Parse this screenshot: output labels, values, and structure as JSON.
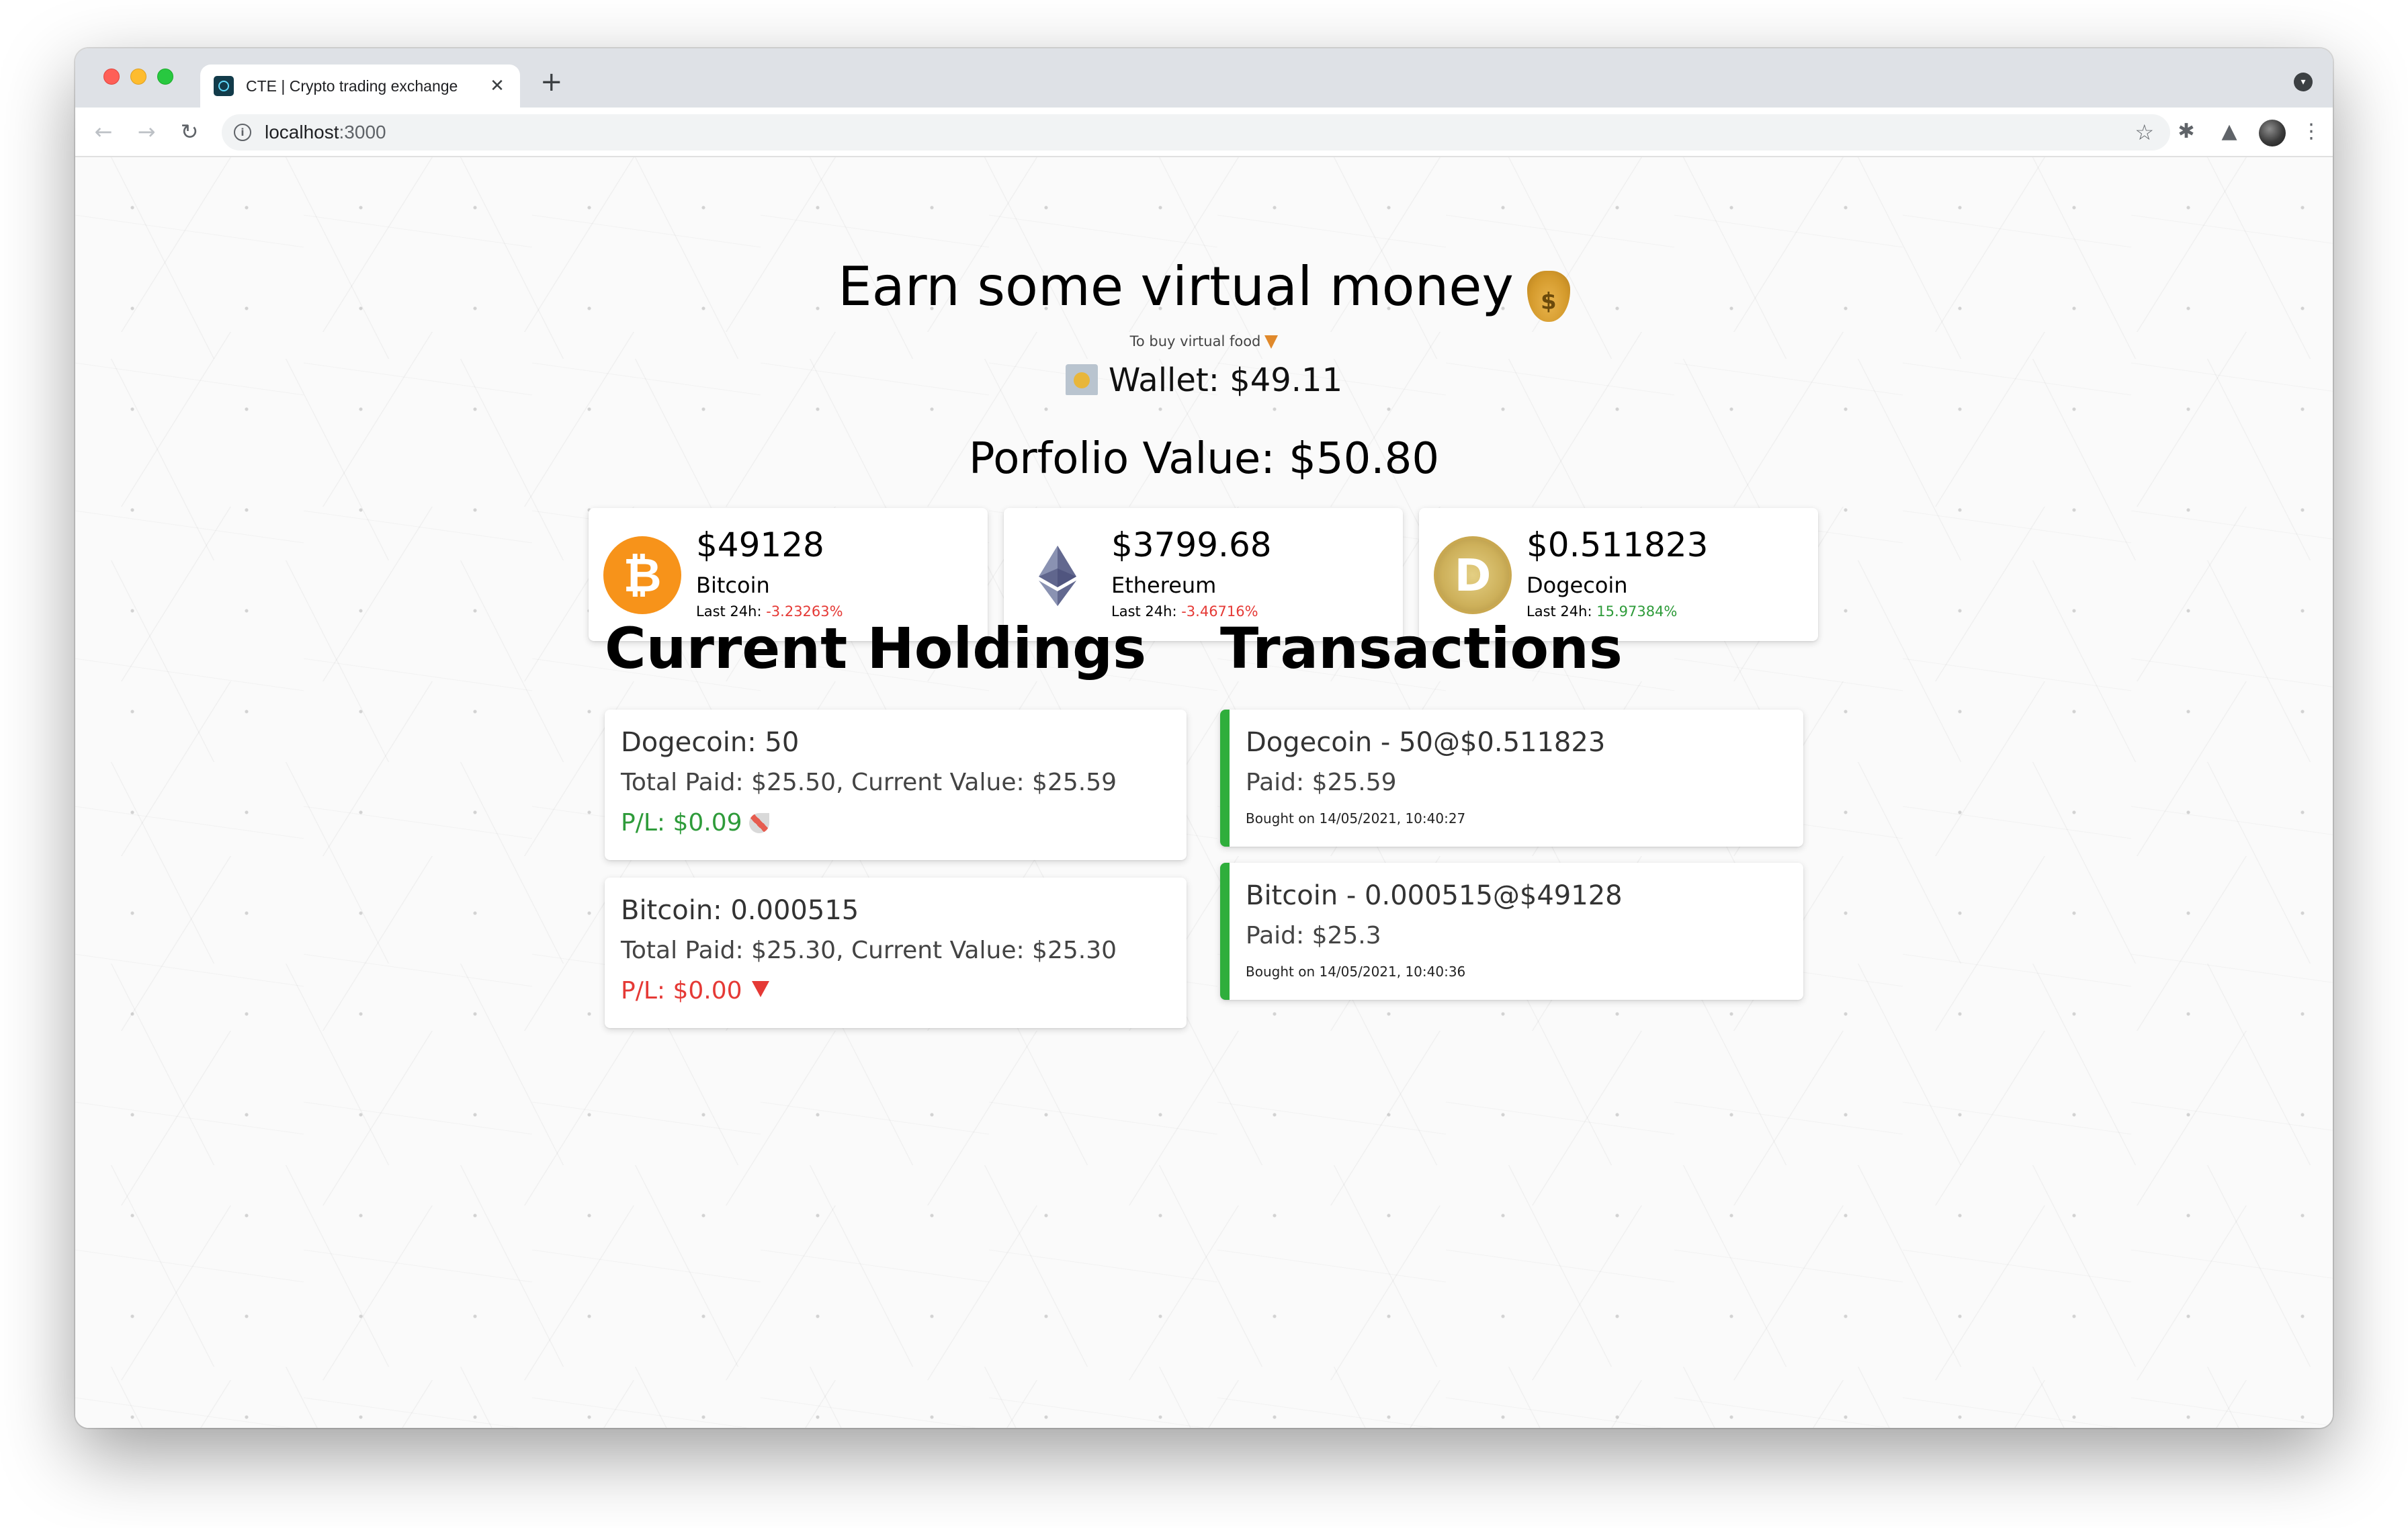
{
  "browser": {
    "tab_title": "CTE | Crypto trading exchange",
    "tab_close": "✕",
    "new_tab": "+",
    "url_host": "localhost",
    "url_port": ":3000",
    "back": "←",
    "forward": "→",
    "reload": "↻",
    "star": "☆",
    "extensions": "✱",
    "labs": "▲",
    "menu": "⋮",
    "profile_menu": "▾"
  },
  "header": {
    "title": "Earn some virtual money",
    "subtitle": "To buy virtual food",
    "wallet_label": "Wallet: $49.11",
    "portfolio_label": "Porfolio Value: $50.80"
  },
  "coins": [
    {
      "name": "Bitcoin",
      "price": "$49128",
      "change_label": "Last 24h:",
      "change": "-3.23263%",
      "logo": "bitcoin-logo",
      "color": "#f7931a"
    },
    {
      "name": "Ethereum",
      "price": "$3799.68",
      "change_label": "Last 24h:",
      "change": "-3.46716%",
      "logo": "ethereum-logo",
      "color": "#627eea"
    },
    {
      "name": "Dogecoin",
      "price": "$0.511823",
      "change_label": "Last 24h:",
      "change": "15.97384%",
      "logo": "dogecoin-logo",
      "color": "#c2a633"
    }
  ],
  "holdings": {
    "title": "Current Holdings",
    "items": [
      {
        "title": "Dogecoin: 50",
        "detail": "Total Paid: $25.50, Current Value: $25.59",
        "pl": "P/L: $0.09",
        "pl_color": "#2e9b3a",
        "icon": "rocket-icon"
      },
      {
        "title": "Bitcoin: 0.000515",
        "detail": "Total Paid: $25.30, Current Value: $25.30",
        "pl": "P/L: $0.00",
        "pl_color": "#e53935",
        "icon": "red-triangle-down-icon"
      }
    ]
  },
  "transactions": {
    "title": "Transactions",
    "items": [
      {
        "title": "Dogecoin - 50@$0.511823",
        "paid": "Paid: $25.59",
        "date": "Bought on 14/05/2021, 10:40:27"
      },
      {
        "title": "Bitcoin - 0.000515@$49128",
        "paid": "Paid: $25.3",
        "date": "Bought on 14/05/2021, 10:40:36"
      }
    ],
    "accent_color": "#2fae3c"
  }
}
